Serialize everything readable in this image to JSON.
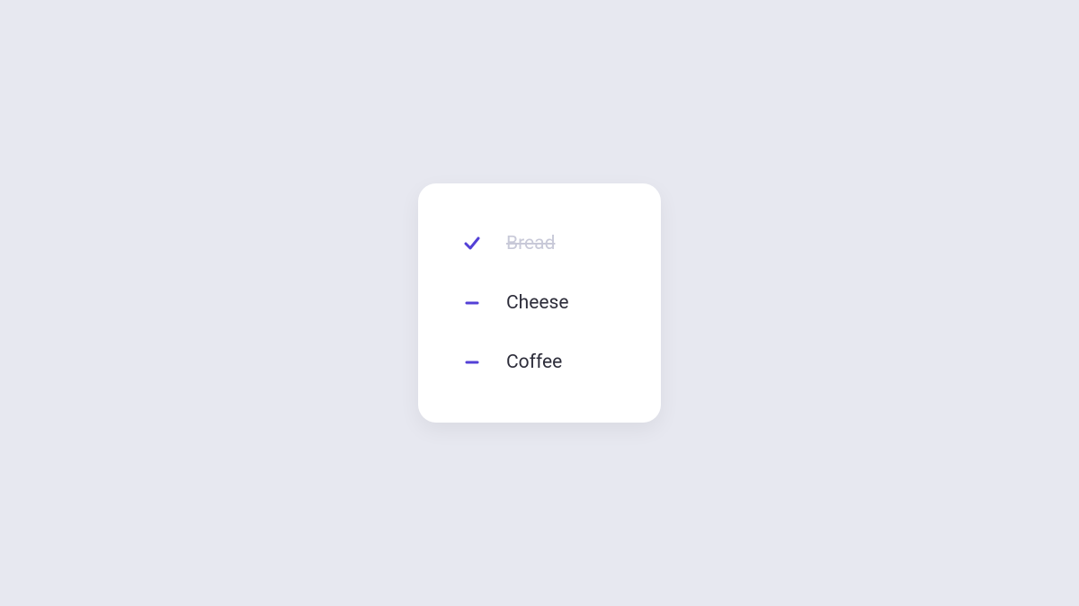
{
  "list": {
    "items": [
      {
        "label": "Bread",
        "done": true
      },
      {
        "label": "Cheese",
        "done": false
      },
      {
        "label": "Coffee",
        "done": false
      }
    ]
  },
  "colors": {
    "accent": "#5340d6",
    "background": "#e7e8f0",
    "card": "#ffffff",
    "text": "#2d2d3a",
    "textDone": "#c8c9d8"
  }
}
